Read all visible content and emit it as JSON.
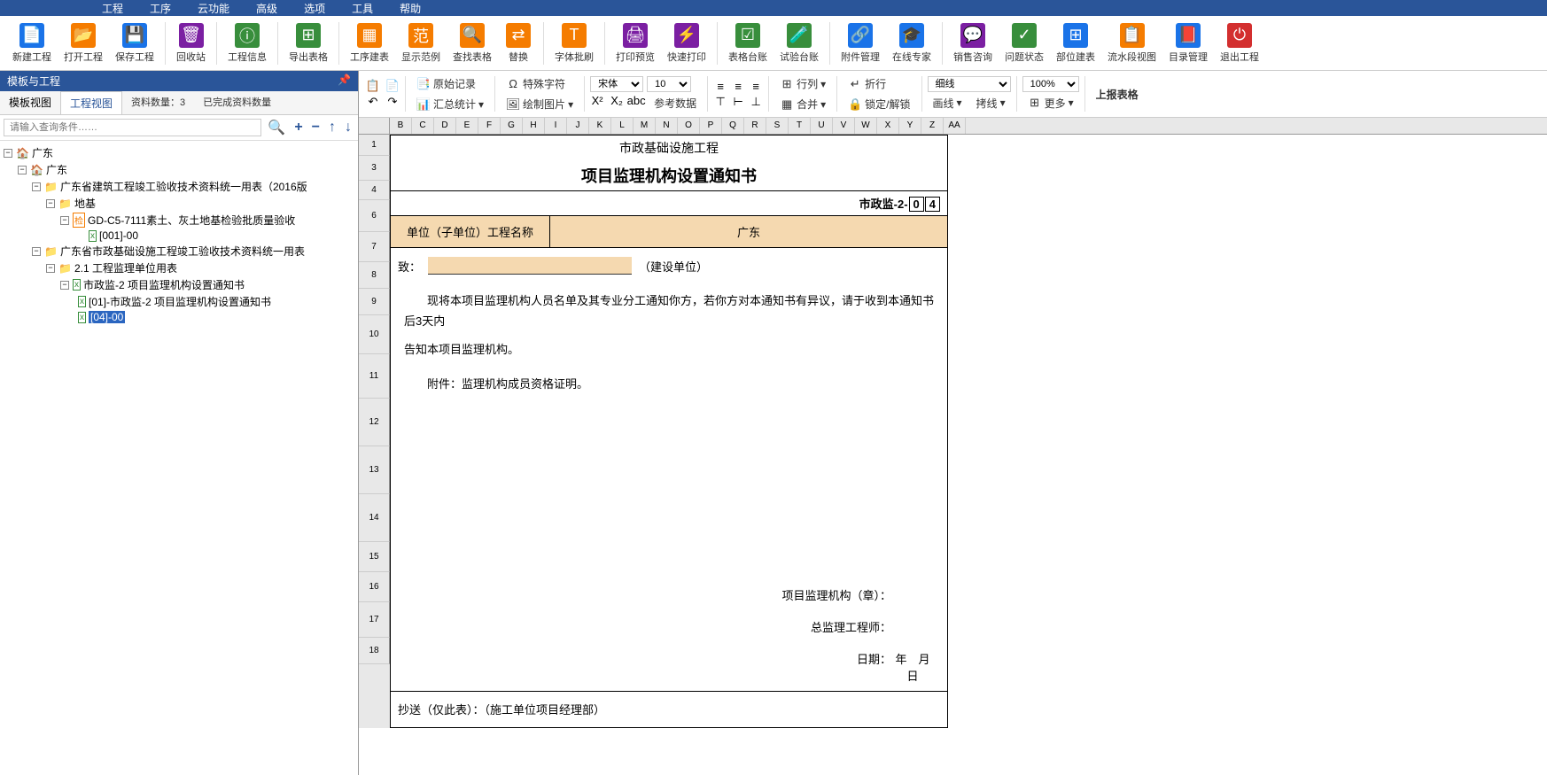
{
  "menu": [
    "工程",
    "工序",
    "云功能",
    "高级",
    "选项",
    "工具",
    "帮助"
  ],
  "ribbon": [
    {
      "label": "新建工程",
      "icon": "📄",
      "cls": "ic-blue"
    },
    {
      "label": "打开工程",
      "icon": "📂",
      "cls": "ic-orange"
    },
    {
      "label": "保存工程",
      "icon": "💾",
      "cls": "ic-blue"
    },
    {
      "sep": true
    },
    {
      "label": "回收站",
      "icon": "🗑",
      "cls": "ic-purple"
    },
    {
      "sep": true
    },
    {
      "label": "工程信息",
      "icon": "ⓘ",
      "cls": "ic-green"
    },
    {
      "sep": true
    },
    {
      "label": "导出表格",
      "icon": "⊞",
      "cls": "ic-green"
    },
    {
      "sep": true
    },
    {
      "label": "工序建表",
      "icon": "▦",
      "cls": "ic-orange"
    },
    {
      "label": "显示范例",
      "icon": "范",
      "cls": "ic-orange"
    },
    {
      "label": "查找表格",
      "icon": "🔍",
      "cls": "ic-orange"
    },
    {
      "label": "替换",
      "icon": "⇄",
      "cls": "ic-orange"
    },
    {
      "sep": true
    },
    {
      "label": "字体批刷",
      "icon": "T",
      "cls": "ic-orange"
    },
    {
      "sep": true
    },
    {
      "label": "打印预览",
      "icon": "🖨",
      "cls": "ic-purple"
    },
    {
      "label": "快速打印",
      "icon": "⚡",
      "cls": "ic-purple"
    },
    {
      "sep": true
    },
    {
      "label": "表格台账",
      "icon": "☑",
      "cls": "ic-green"
    },
    {
      "label": "试验台账",
      "icon": "🧪",
      "cls": "ic-green"
    },
    {
      "sep": true
    },
    {
      "label": "附件管理",
      "icon": "🔗",
      "cls": "ic-blue"
    },
    {
      "label": "在线专家",
      "icon": "🎓",
      "cls": "ic-blue"
    },
    {
      "sep": true
    },
    {
      "label": "销售咨询",
      "icon": "💬",
      "cls": "ic-purple"
    },
    {
      "label": "问题状态",
      "icon": "✓",
      "cls": "ic-green"
    },
    {
      "label": "部位建表",
      "icon": "⊞",
      "cls": "ic-blue"
    },
    {
      "label": "流水段视图",
      "icon": "📋",
      "cls": "ic-orange"
    },
    {
      "label": "目录管理",
      "icon": "📕",
      "cls": "ic-blue"
    },
    {
      "label": "退出工程",
      "icon": "⏻",
      "cls": "ic-red"
    }
  ],
  "panel": {
    "title": "模板与工程",
    "pin": "📌",
    "tab1": "模板视图",
    "tab2": "工程视图",
    "info1": "资料数量：3",
    "info2": "已完成资料数量",
    "search_placeholder": "请输入查询条件……"
  },
  "tree": {
    "root": "广东",
    "sub": "广东",
    "n1": "广东省建筑工程竣工验收技术资料统一用表（2016版",
    "n1_1": "地基",
    "n1_1_1": "GD-C5-7111素土、灰土地基检验批质量验收",
    "n1_1_1_1": "[001]-00",
    "n2": "广东省市政基础设施工程竣工验收技术资料统一用表",
    "n2_1": "2.1 工程监理单位用表",
    "n2_1_1": "市政监-2 项目监理机构设置通知书",
    "n2_1_1_1": "[01]-市政监-2 项目监理机构设置通知书",
    "n2_1_1_2": "[04]-00"
  },
  "toolbar2": {
    "original": "原始记录",
    "special": "特殊字符",
    "font": "宋体",
    "size": "10",
    "rowcol": "行列",
    "wrap": "折行",
    "line_thin": "细线",
    "zoom": "100%",
    "report": "上报表格",
    "stats": "汇总统计",
    "draw": "绘制图片",
    "ref": "参考数据",
    "merge": "合并",
    "lock": "锁定/解锁",
    "brush": "画线",
    "copyline": "拷线",
    "more": "更多"
  },
  "cols": [
    "B",
    "C",
    "D",
    "E",
    "F",
    "G",
    "H",
    "I",
    "J",
    "K",
    "L",
    "M",
    "N",
    "O",
    "P",
    "Q",
    "R",
    "S",
    "T",
    "U",
    "V",
    "W",
    "X",
    "Y",
    "Z",
    "AA"
  ],
  "rows": [
    "1",
    "3",
    "4",
    "6",
    "7",
    "8",
    "9",
    "10",
    "11",
    "12",
    "13",
    "14",
    "15",
    "16",
    "17",
    "18"
  ],
  "doc": {
    "t1": "市政基础设施工程",
    "t2": "项目监理机构设置通知书",
    "code_pre": "市政监-2-",
    "code_a": "0",
    "code_b": "4",
    "unit_label": "单位（子单位）工程名称",
    "unit_value": "广东",
    "to": "致：",
    "to_suffix": "（建设单位）",
    "body1": "　　现将本项目监理机构人员名单及其专业分工通知你方，若你方对本通知书有异议，请于收到本通知书后3天内",
    "body2": "告知本项目监理机构。",
    "body3": "　　附件：监理机构成员资格证明。",
    "sig1": "项目监理机构（章）：",
    "sig2": "总监理工程师：",
    "sig3": "日期：",
    "date_fmt": "年　月　日",
    "cc": "抄送（仅此表）：（施工单位项目经理部）"
  }
}
